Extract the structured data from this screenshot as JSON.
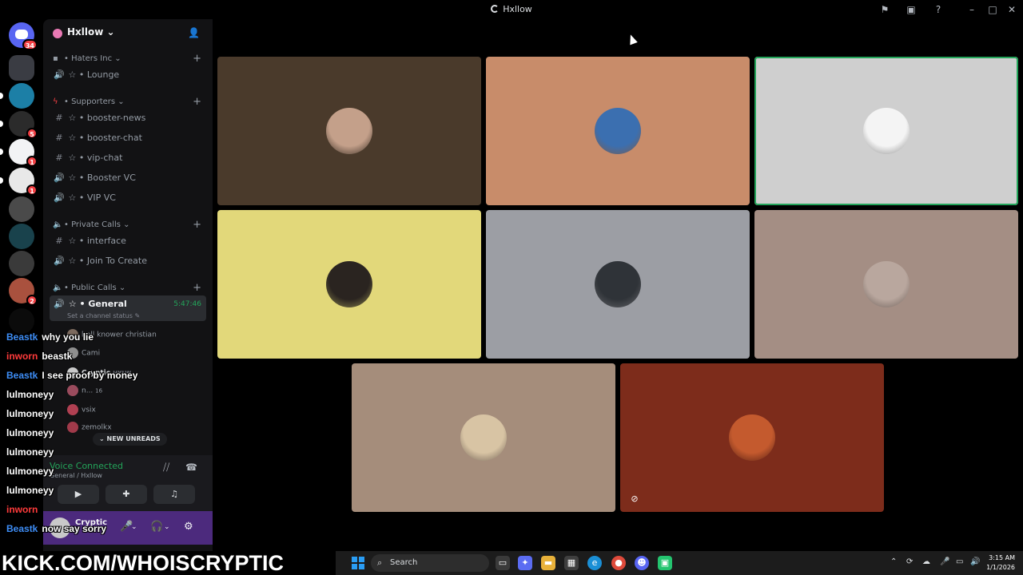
{
  "window": {
    "title": "Hxllow"
  },
  "rail": {
    "home_badge": "34",
    "servers": [
      {
        "badge": "",
        "color": "#3a3c43"
      },
      {
        "badge": "",
        "color": "#1c7fa6"
      },
      {
        "badge": "5",
        "color": "#2b2b2b"
      },
      {
        "badge": "1",
        "color": "#f2f3f5"
      },
      {
        "badge": "1",
        "color": "#e8e8e8"
      },
      {
        "badge": "",
        "color": "#4a4a4a"
      },
      {
        "badge": "",
        "color": "#19424c"
      },
      {
        "badge": "",
        "color": "#3a3a3a"
      },
      {
        "badge": "2",
        "color": "#a9513e"
      },
      {
        "badge": "",
        "color": "#0b0b0b"
      }
    ]
  },
  "sidebar": {
    "server_name": "Hxllow",
    "categories": [
      {
        "name": "Haters Inc",
        "channels": [
          {
            "type": "voice",
            "name": "Lounge"
          }
        ]
      },
      {
        "name": "Supporters",
        "channels": [
          {
            "type": "text",
            "name": "booster-news"
          },
          {
            "type": "text",
            "name": "booster-chat"
          },
          {
            "type": "text",
            "name": "vip-chat"
          },
          {
            "type": "voice",
            "name": "Booster VC"
          },
          {
            "type": "voice",
            "name": "VIP VC"
          }
        ]
      },
      {
        "name": "Private Calls",
        "channels": [
          {
            "type": "text",
            "name": "interface"
          },
          {
            "type": "voice",
            "name": "Join To Create"
          }
        ]
      },
      {
        "name": "Public Calls",
        "channels": [
          {
            "type": "voice",
            "name": "General",
            "timer": "5:47:46",
            "active": true
          }
        ]
      }
    ],
    "channel_status": "Set a channel status",
    "voice_members": [
      {
        "name": "hell knower christian"
      },
      {
        "name": "Cami"
      },
      {
        "name": "Cryptic",
        "tag": "HXLW"
      },
      {
        "name": "n...",
        "extra": "16"
      },
      {
        "name": "vsix"
      },
      {
        "name": "zemolkx"
      }
    ],
    "new_unreads": "NEW UNREADS",
    "voice_connected": "Voice Connected",
    "voice_sub": "General / Hxllow",
    "user": {
      "name": "Cryptic"
    }
  },
  "chat": [
    {
      "user": "Beastk",
      "color": "#3e8ef7",
      "msg": "why you lie"
    },
    {
      "user": "inworn",
      "color": "#ff3b3b",
      "msg": "beastk"
    },
    {
      "user": "Beastk",
      "color": "#3e8ef7",
      "msg": "I see proof by money"
    },
    {
      "user": "lulmoneyy",
      "color": "#ffffff",
      "msg": ""
    },
    {
      "user": "lulmoneyy",
      "color": "#ffffff",
      "msg": ""
    },
    {
      "user": "lulmoneyy",
      "color": "#ffffff",
      "msg": ""
    },
    {
      "user": "lulmoneyy",
      "color": "#ffffff",
      "msg": ""
    },
    {
      "user": "lulmoneyy",
      "color": "#ffffff",
      "msg": ""
    },
    {
      "user": "lulmoneyy",
      "color": "#ffffff",
      "msg": ""
    },
    {
      "user": "inworn",
      "color": "#ff3b3b",
      "msg": ""
    },
    {
      "user": "Beastk",
      "color": "#3e8ef7",
      "msg": "now say sorry"
    }
  ],
  "banner": "KICK.COM/WHOISCRYPTIC",
  "tiles": [
    {
      "bg": "#4a3a2b",
      "avatar": "#c4a08a",
      "speaking": false,
      "muted": false
    },
    {
      "bg": "#c88c6a",
      "avatar": "#3b6fb0",
      "speaking": false,
      "muted": false
    },
    {
      "bg": "#cfcfcf",
      "avatar": "#f4f4f4",
      "speaking": true,
      "muted": false
    },
    {
      "bg": "#e2d87a",
      "avatar": "#2a2420",
      "speaking": false,
      "muted": false
    },
    {
      "bg": "#9c9ea4",
      "avatar": "#2f3338",
      "speaking": false,
      "muted": false
    },
    {
      "bg": "#a48e84",
      "avatar": "#b9a79e",
      "speaking": false,
      "muted": false
    },
    {
      "bg": "#a58d7b",
      "avatar": "#d8c4a4",
      "speaking": false,
      "muted": false
    },
    {
      "bg": "#7d2c1b",
      "avatar": "#c45a2e",
      "speaking": false,
      "muted": true
    }
  ],
  "taskbar": {
    "search_placeholder": "Search",
    "time": "3:15 AM",
    "date": "1/1/2026"
  }
}
